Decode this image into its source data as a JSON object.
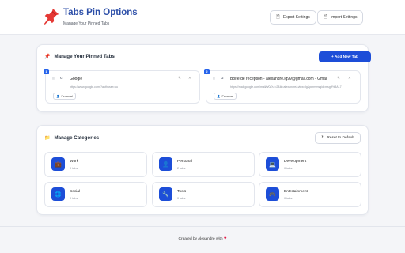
{
  "header": {
    "title": "Tabs Pin Options",
    "subtitle": "Manage Your Pinned Tabs",
    "export_label": "Export Settings",
    "import_label": "Import Settings"
  },
  "pinned": {
    "section_title": "Manage Your Pinned Tabs",
    "add_label": "+ Add New Tab",
    "tabs": [
      {
        "number": "1",
        "title": "Google",
        "url": "https://www.google.com/?authuser=uu",
        "category": "Personal"
      },
      {
        "number": "2",
        "title": "Boîte de réception - alexandre.lg99@gmail.com - Gmail",
        "url": "https://mail.google.com/mail/u/0/?ui=2&ik=alexandre&view=lg&permmsgid=msg-f%3A17",
        "category": "Personal"
      }
    ]
  },
  "categories": {
    "section_title": "Manage Categories",
    "reset_label": "Reset to Default",
    "items": [
      {
        "name": "Work",
        "count": "0 tabs",
        "icon": "briefcase-icon",
        "glyph": "💼"
      },
      {
        "name": "Personal",
        "count": "2 tabs",
        "icon": "person-icon",
        "glyph": "👤"
      },
      {
        "name": "Development",
        "count": "0 tabs",
        "icon": "laptop-icon",
        "glyph": "💻"
      },
      {
        "name": "Social",
        "count": "0 tabs",
        "icon": "globe-icon",
        "glyph": "🌐"
      },
      {
        "name": "Tools",
        "count": "0 tabs",
        "icon": "wrench-icon",
        "glyph": "🔧"
      },
      {
        "name": "Entertainment",
        "count": "0 tabs",
        "icon": "gamepad-icon",
        "glyph": "🎮"
      }
    ]
  },
  "footer": {
    "text": "Created by Alexandre with",
    "heart": "♥"
  },
  "colors": {
    "accent": "#1d4ed8",
    "title": "#2d4fa8",
    "heart": "#e11d48"
  }
}
